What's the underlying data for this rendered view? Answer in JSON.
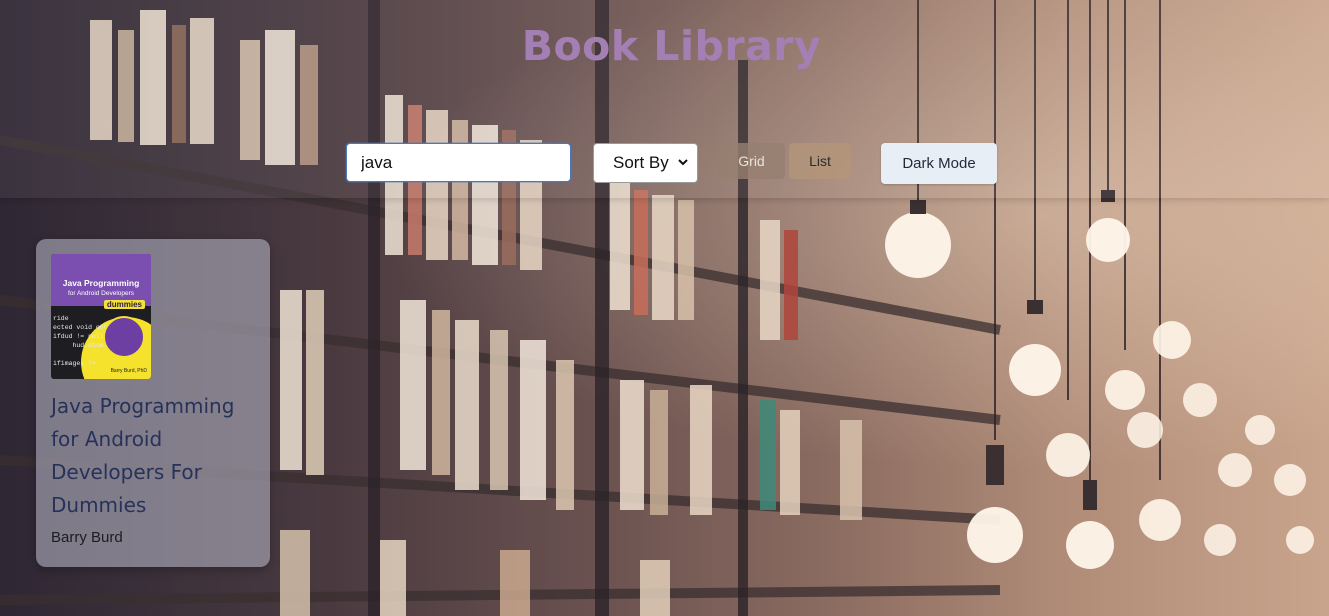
{
  "app": {
    "title": "Book Library"
  },
  "toolbar": {
    "search_value": "java",
    "sort_label": "Sort By",
    "grid_label": "Grid",
    "list_label": "List",
    "dark_mode_label": "Dark Mode"
  },
  "books": [
    {
      "title": "Java Programming for Android Developers For Dummies",
      "author": "Barry Burd",
      "cover": {
        "title": "Java Programming",
        "subtitle": "for Android Developers",
        "brand": "dummies",
        "code": "ride\nected void onC\nifdud != null\n     hud.dismis\n\nifimages !=",
        "author": "Barry Burd, PhD"
      }
    }
  ],
  "colors": {
    "title": "#a47fb4",
    "card_title": "#27325a",
    "dark_button_bg": "#e8eef5"
  }
}
